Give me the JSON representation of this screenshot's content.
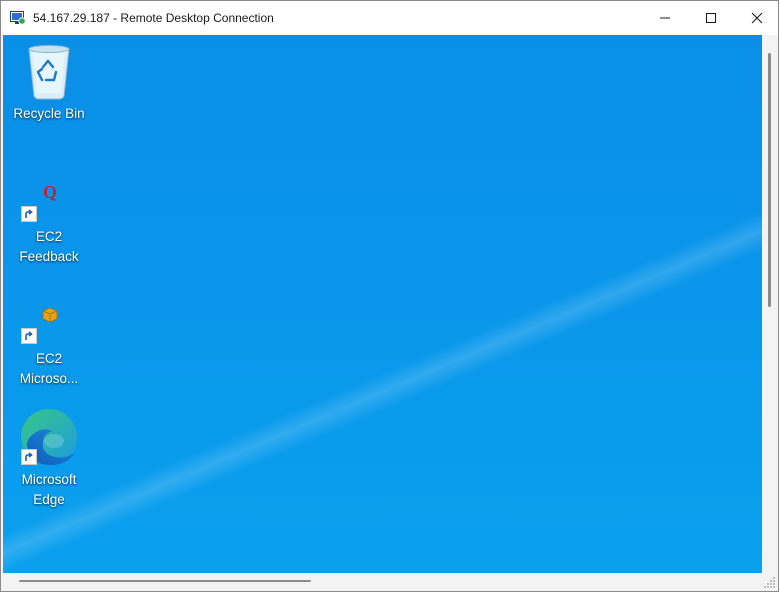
{
  "window": {
    "title": "54.167.29.187 - Remote Desktop Connection",
    "controls": [
      "minimize-icon",
      "maximize-icon",
      "close-icon"
    ]
  },
  "desktop": {
    "icons": [
      {
        "id": "recycle-bin",
        "label_line1": "Recycle Bin",
        "label_line2": "",
        "icon": "recycle-bin-icon",
        "shortcut": false
      },
      {
        "id": "ec2-feedback",
        "label_line1": "EC2",
        "label_line2": "Feedback",
        "icon": "feedback-q-icon",
        "shortcut": true
      },
      {
        "id": "ec2-microsoft",
        "label_line1": "EC2",
        "label_line2": "Microso...",
        "icon": "package-box-icon",
        "shortcut": true
      },
      {
        "id": "microsoft-edge",
        "label_line1": "Microsoft",
        "label_line2": "Edge",
        "icon": "edge-icon",
        "shortcut": true
      }
    ]
  },
  "colors": {
    "desktop_background": "#0a95ea",
    "title_bar": "#ffffff",
    "scrollbar": "#f3f3f3"
  }
}
